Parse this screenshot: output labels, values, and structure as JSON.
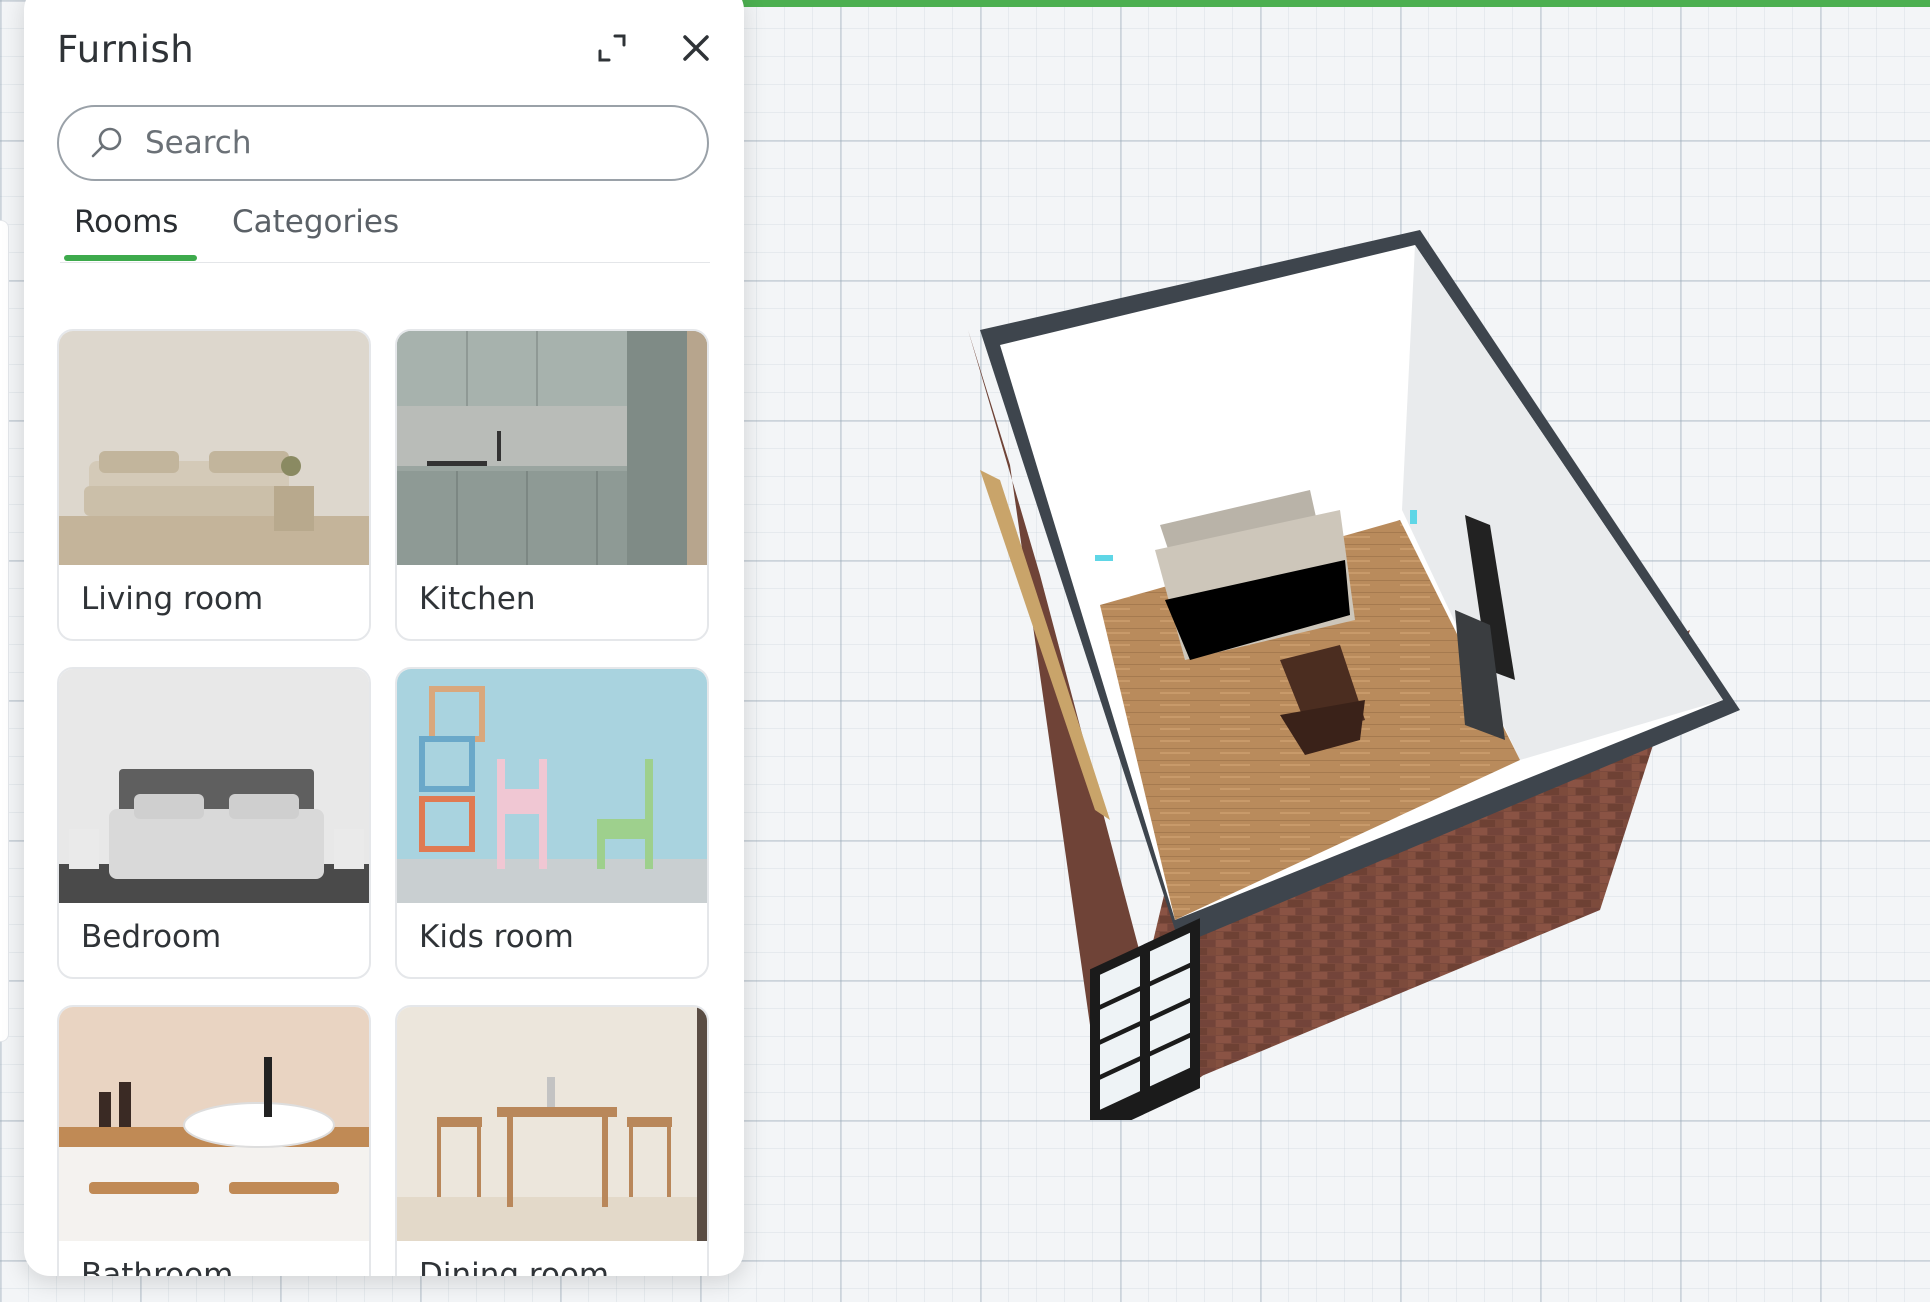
{
  "accent_color": "#3daa4c",
  "panel": {
    "title": "Furnish",
    "expand_icon": "expand-icon",
    "close_icon": "close-icon"
  },
  "search": {
    "placeholder": "Search",
    "icon": "search-icon"
  },
  "tabs": [
    {
      "label": "Rooms",
      "active": true
    },
    {
      "label": "Categories",
      "active": false
    }
  ],
  "rooms": [
    {
      "label": "Living room"
    },
    {
      "label": "Kitchen"
    },
    {
      "label": "Bedroom"
    },
    {
      "label": "Kids room"
    },
    {
      "label": "Bathroom"
    },
    {
      "label": "Dining room"
    }
  ]
}
